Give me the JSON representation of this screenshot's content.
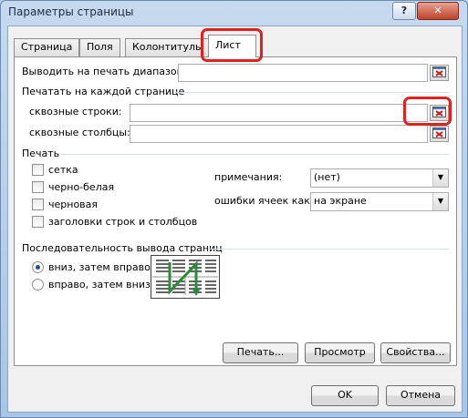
{
  "window": {
    "title": "Параметры страницы",
    "help_label": "?",
    "close_label": "✕"
  },
  "tabs": [
    "Страница",
    "Поля",
    "Колонтитулы",
    "Лист"
  ],
  "print_area": {
    "label": "Выводить на печать диапазон:",
    "value": ""
  },
  "titles": {
    "heading": "Печатать на каждой странице",
    "rows_label": "сквозные строки:",
    "cols_label": "сквозные столбцы:"
  },
  "print": {
    "heading": "Печать",
    "checkboxes": [
      "сетка",
      "черно-белая",
      "черновая",
      "заголовки строк и столбцов"
    ],
    "comments_label": "примечания:",
    "comments_value": "(нет)",
    "errors_label": "ошибки ячеек как:",
    "errors_value": "на экране"
  },
  "order": {
    "heading": "Последовательность вывода страниц",
    "options": [
      "вниз, затем вправо",
      "вправо, затем вниз"
    ],
    "selected": "вниз, затем вправо"
  },
  "buttons": {
    "print": "Печать...",
    "preview": "Просмотр",
    "properties": "Свойства...",
    "ok": "OK",
    "cancel": "Отмена"
  },
  "colors": {
    "highlight": "#e0211f",
    "accent": "#1f4e9e"
  },
  "icons": {
    "collapse": "collapse-dialog-icon",
    "order": "page-order-icon"
  }
}
